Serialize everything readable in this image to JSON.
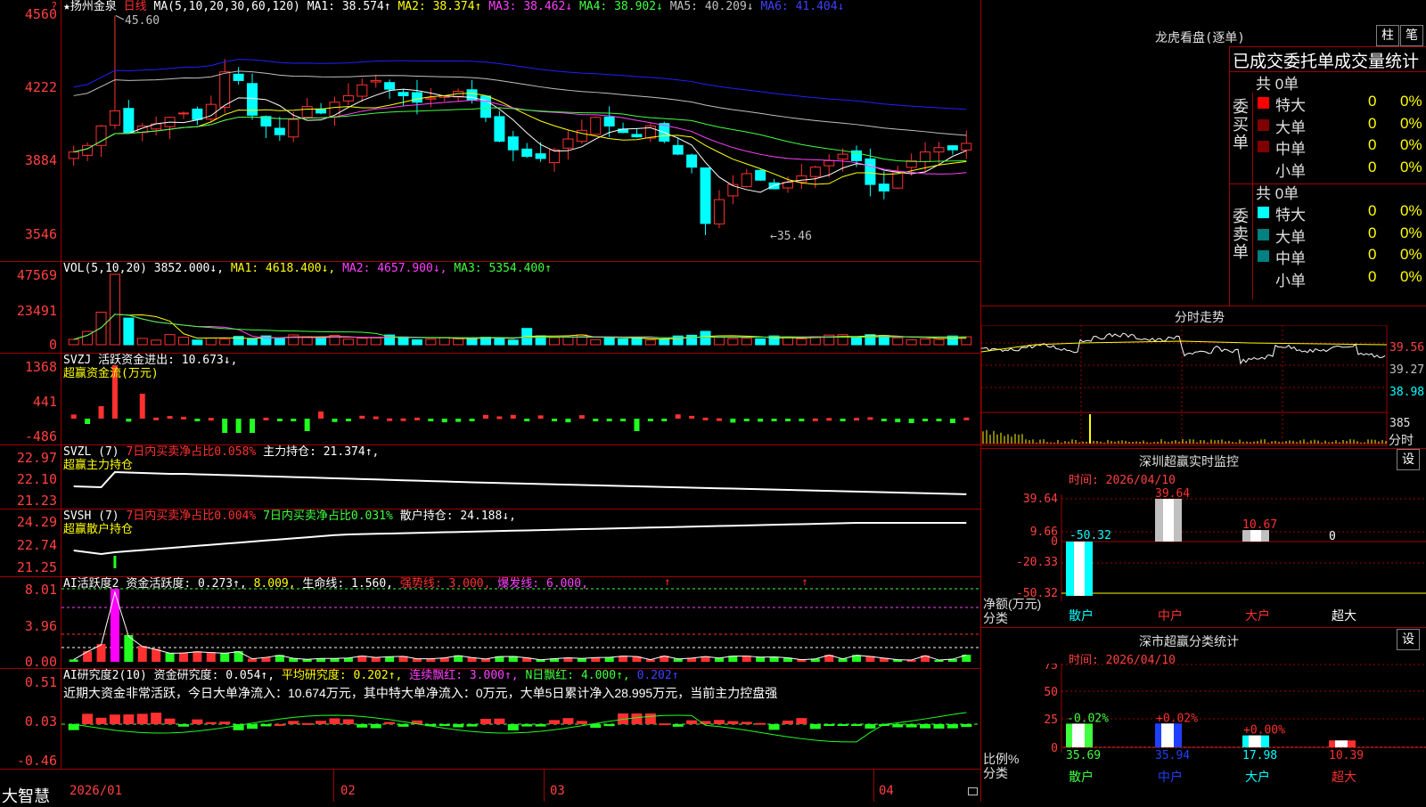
{
  "corner": {
    "top_left": "?",
    "top_left2": "?"
  },
  "brand": "大智慧",
  "price_pane": {
    "stock": "★扬州金泉",
    "period": "日线",
    "ma_header": "MA(5,10,20,30,60,120)",
    "ma1": "MA1: 38.574↑",
    "ma2": "MA2: 38.374↑",
    "ma3": "MA3: 38.462↓",
    "ma4": "MA4: 38.902↓",
    "ma5": "MA5: 40.209↓",
    "ma6": "MA6: 41.404↓",
    "yticks": [
      "4560",
      "4222",
      "3884",
      "3546"
    ],
    "high_label": "45.60",
    "low_label": "←35.46"
  },
  "vol_pane": {
    "header": "VOL(5,10,20)",
    "value": "3852.000↓,",
    "ma1": "MA1: 4618.400↓,",
    "ma2": "MA2: 4657.900↓,",
    "ma3": "MA3: 5354.400↑",
    "yticks": [
      "47569",
      "23491",
      "0"
    ]
  },
  "svzj_pane": {
    "header": "SVZJ  活跃资金进出: 10.673↓,",
    "sub": "超赢资金流(万元)",
    "yticks": [
      "1368",
      "441",
      "-486"
    ]
  },
  "svzl_pane": {
    "h1": "SVZL (7)",
    "h2": "7日内买卖净占比0.058%",
    "h3": "主力持仓: 21.374↑,",
    "sub": "超赢主力持仓",
    "yticks": [
      "22.97",
      "22.10",
      "21.23"
    ]
  },
  "svsh_pane": {
    "h1": "SVSH (7)",
    "h2": "7日内买卖净占比0.004%",
    "h3": "7日内买卖净占比0.031%",
    "h4": "散户持仓: 24.188↓,",
    "sub": "超赢散户持仓",
    "yticks": [
      "24.29",
      "22.74",
      "21.25"
    ]
  },
  "ai_act_pane": {
    "h1": "AI活跃度2",
    "h2": "资金活跃度: 0.273↑,",
    "h3": "8.009,",
    "h4": "生命线: 1.560,",
    "h5": "强势线: 3.000,",
    "h6": "爆发线: 6.000,",
    "yticks": [
      "8.01",
      "3.96",
      "0.00"
    ]
  },
  "ai_res_pane": {
    "h1": "AI研究度2(10)",
    "h2": "资金研究度: 0.054↑,",
    "h3": "平均研究度: 0.202↑,",
    "h4": "连续飘红: 3.000↑,",
    "h5": "N日飘红: 4.000↑,",
    "h6": "0.202↑",
    "note": "近期大资金非常活跃，今日大单净流入：10.674万元，其中特大单净流入：0万元，大单5日累计净入28.995万元，当前主力控盘强",
    "yticks": [
      "0.51",
      "0.03",
      "-0.46"
    ]
  },
  "x_axis": [
    "2026/01",
    "02",
    "03",
    "04"
  ],
  "longhu": {
    "title": "龙虎看盘(逐单)",
    "btn1": "柱",
    "btn2": "笔",
    "subtitle": "已成交委托单成交量统计",
    "buy_total": "共 0单",
    "buy_label": "委买单",
    "sell_total": "共 0单",
    "sell_label": "委卖单",
    "rows": [
      {
        "name": "特大",
        "count": "0",
        "pct": "0%"
      },
      {
        "name": "大单",
        "count": "0",
        "pct": "0%"
      },
      {
        "name": "中单",
        "count": "0",
        "pct": "0%"
      },
      {
        "name": "小单",
        "count": "0",
        "pct": "0%"
      }
    ],
    "sell_rows": [
      {
        "name": "特大",
        "count": "0",
        "pct": "0%"
      },
      {
        "name": "大单",
        "count": "0",
        "pct": "0%"
      },
      {
        "name": "中单",
        "count": "0",
        "pct": "0%"
      },
      {
        "name": "小单",
        "count": "0",
        "pct": "0%"
      }
    ]
  },
  "intraday": {
    "title": "分时走势",
    "yticks": [
      "39.56",
      "39.27",
      "38.98"
    ],
    "vol_label": "385",
    "x_label": "分时"
  },
  "sz_monitor": {
    "title": "深圳超赢实时监控",
    "btn": "设",
    "time": "时间: 2026/04/10",
    "yticks": [
      "39.64",
      "9.66",
      "0",
      "-20.33",
      "-50.32"
    ],
    "axis_label1": "净额(万元)",
    "axis_label2": "分类",
    "bars": [
      {
        "cat": "散户",
        "value": -50.32,
        "label": "-50.32"
      },
      {
        "cat": "中户",
        "value": 39.64,
        "label": "39.64"
      },
      {
        "cat": "大户",
        "value": 10.67,
        "label": "10.67"
      },
      {
        "cat": "超大",
        "value": 0,
        "label": "0"
      }
    ]
  },
  "sz_class": {
    "title": "深市超赢分类统计",
    "btn": "设",
    "time": "时间: 2026/04/10",
    "yticks": [
      "75",
      "50",
      "25",
      "0"
    ],
    "axis_label1": "比例%",
    "axis_label2": "分类",
    "bars": [
      {
        "cat": "散户",
        "value": 35.69,
        "delta": "-0.02%",
        "label": "35.69",
        "color": "#40ff40"
      },
      {
        "cat": "中户",
        "value": 35.94,
        "delta": "+0.02%",
        "label": "35.94",
        "color": "#2040ff"
      },
      {
        "cat": "大户",
        "value": 17.98,
        "delta": "+0.00%",
        "label": "17.98",
        "color": "#00ffff"
      },
      {
        "cat": "超大",
        "value": 10.39,
        "delta": "",
        "label": "10.39",
        "color": "#ff3030"
      }
    ]
  },
  "colors": {
    "up": "#ff3030",
    "down": "#00ffff",
    "grid": "#a00000"
  }
}
